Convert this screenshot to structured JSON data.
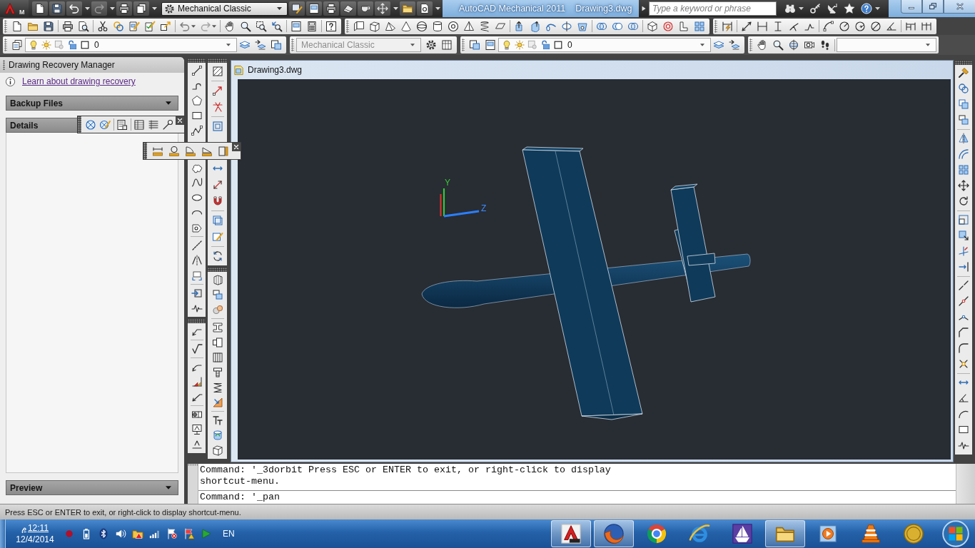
{
  "title_bar": {
    "app_menu": "M",
    "workspace": "Mechanical Classic",
    "app_title": "AutoCAD Mechanical 2011",
    "document": "Drawing3.dwg",
    "search": {
      "placeholder": "Type a keyword or phrase"
    }
  },
  "layer_bar": {
    "layer": "0",
    "text_style": {
      "value": "Mechanical Classic",
      "disabled": true
    },
    "layer_2": "0"
  },
  "recovery_manager": {
    "title": "Drawing Recovery Manager",
    "link": "Learn about drawing recovery",
    "sections": [
      {
        "label": "Backup Files",
        "expanded": false
      },
      {
        "label": "Details",
        "expanded": true
      },
      {
        "label": "Preview",
        "expanded": false
      }
    ]
  },
  "drawing_window": {
    "title": "Drawing3.dwg",
    "axis_labels": [
      "Y",
      "Z"
    ]
  },
  "command_line": {
    "history": [
      "Command: '_3dorbit Press ESC or ENTER to exit, or right-click to display",
      "shortcut-menu."
    ],
    "prompt": "Command: '_pan"
  },
  "status_bar": {
    "message": "Press ESC or ENTER to exit, or right-click to display shortcut-menu."
  },
  "taskbar": {
    "clock": {
      "period": "م",
      "time": "12:11",
      "date": "12/4/2014"
    },
    "language": "EN",
    "apps": [
      {
        "open": true
      },
      {
        "open": true
      },
      {
        "open": false
      },
      {
        "open": false
      },
      {
        "open": false
      },
      {
        "open": true
      },
      {
        "open": false
      },
      {
        "open": false
      },
      {
        "open": false
      }
    ]
  }
}
